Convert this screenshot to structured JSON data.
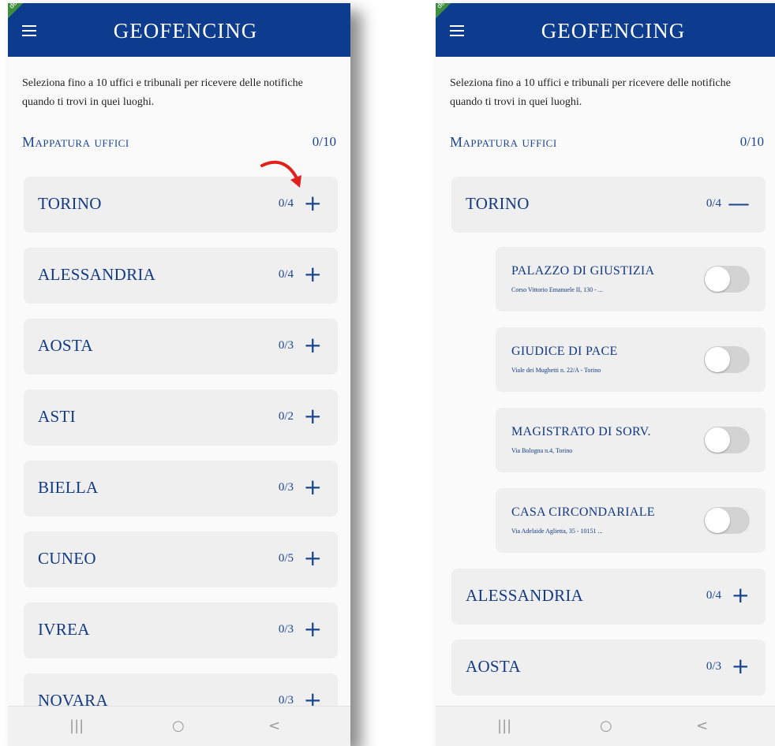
{
  "app": {
    "title": "GEOFENCING",
    "ribbon": "dev"
  },
  "intro": "Seleziona fino a 10 uffici e tribunali per ricevere delle notifiche quando ti trovi in quei luoghi.",
  "section": {
    "title": "Mappatura uffici",
    "count": "0/10"
  },
  "left_cities": [
    {
      "name": "TORINO",
      "count": "0/4",
      "toggle": "+"
    },
    {
      "name": "ALESSANDRIA",
      "count": "0/4",
      "toggle": "+"
    },
    {
      "name": "AOSTA",
      "count": "0/3",
      "toggle": "+"
    },
    {
      "name": "ASTI",
      "count": "0/2",
      "toggle": "+"
    },
    {
      "name": "BIELLA",
      "count": "0/3",
      "toggle": "+"
    },
    {
      "name": "CUNEO",
      "count": "0/5",
      "toggle": "+"
    },
    {
      "name": "IVREA",
      "count": "0/3",
      "toggle": "+"
    },
    {
      "name": "NOVARA",
      "count": "0/3",
      "toggle": "+"
    }
  ],
  "right_expanded": {
    "name": "TORINO",
    "count": "0/4",
    "toggle": "—"
  },
  "offices": [
    {
      "name": "PALAZZO DI GIUSTIZIA",
      "address": "Corso Vittorio Emanuele II, 130 - ...",
      "enabled": false
    },
    {
      "name": "GIUDICE DI PACE",
      "address": "Viale dei Mughetti n. 22/A - Torino",
      "enabled": false
    },
    {
      "name": "MAGISTRATO DI SORV.",
      "address": "Via Bologna n.4, Torino",
      "enabled": false
    },
    {
      "name": "CASA CIRCONDARIALE",
      "address": "Via Adelaide Aglietta, 35 - 10151 ...",
      "enabled": false
    }
  ],
  "right_cities": [
    {
      "name": "ALESSANDRIA",
      "count": "0/4",
      "toggle": "+"
    },
    {
      "name": "AOSTA",
      "count": "0/3",
      "toggle": "+"
    }
  ],
  "nav": {
    "recent": "|||",
    "home": "○",
    "back": "<"
  },
  "colors": {
    "appbar": "#0d3c8e",
    "accent": "#1a4593",
    "annotation_arrow": "#e0201b"
  }
}
